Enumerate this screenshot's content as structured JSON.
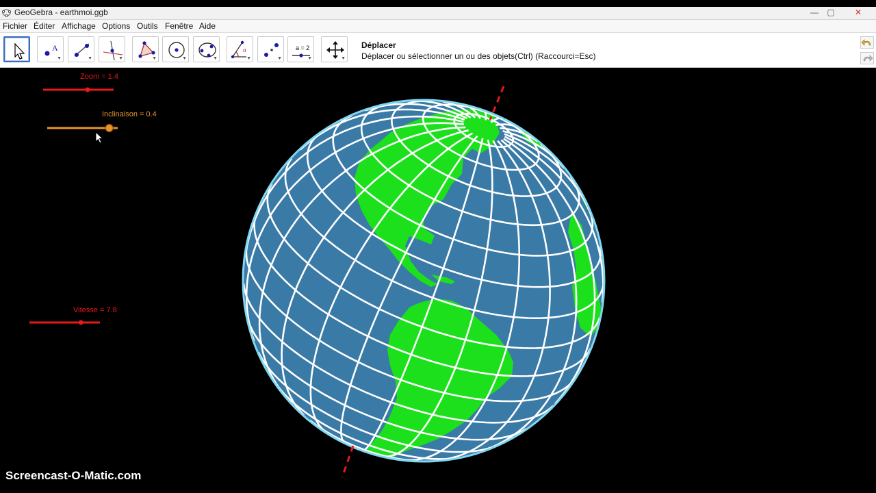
{
  "window": {
    "title": "GeoGebra - earthmoi.ggb",
    "minimize_label": "—",
    "maximize_label": "▢",
    "close_label": "✕"
  },
  "menu": [
    "Fichier",
    "Éditer",
    "Affichage",
    "Options",
    "Outils",
    "Fenêtre",
    "Aide"
  ],
  "toolbar": {
    "tools": [
      "move-tool",
      "point-tool",
      "line-tool",
      "perpendicular-line-tool",
      "polygon-tool",
      "circle-center-point-tool",
      "conic-tool",
      "angle-tool",
      "reflect-tool",
      "slider-tool",
      "move-graphics-view-tool"
    ],
    "active_tool_name": "Déplacer",
    "active_tool_help": "Déplacer ou sélectionner un ou des objets(Ctrl) (Raccourci=Esc)",
    "slider_icon_text": "a = 2"
  },
  "sliders": {
    "zoom": {
      "label": "Zoom = 1.4",
      "value": 1.4,
      "fill_fraction": 0.63,
      "color": "#e31b1b"
    },
    "inclinaison": {
      "label": "Inclinaison = 0.4",
      "value": 0.4,
      "fill_fraction": 0.88,
      "color": "#e8922a"
    },
    "vitesse": {
      "label": "Vitesse = 7.8",
      "value": 7.8,
      "fill_fraction": 0.73,
      "color": "#e31b1b"
    }
  },
  "globe": {
    "ocean_color": "#3a7aa6",
    "land_color": "#1de01d",
    "grid_color": "#ffffff",
    "axis_color": "#e31b1b"
  },
  "watermark": "Screencast-O-Matic.com"
}
